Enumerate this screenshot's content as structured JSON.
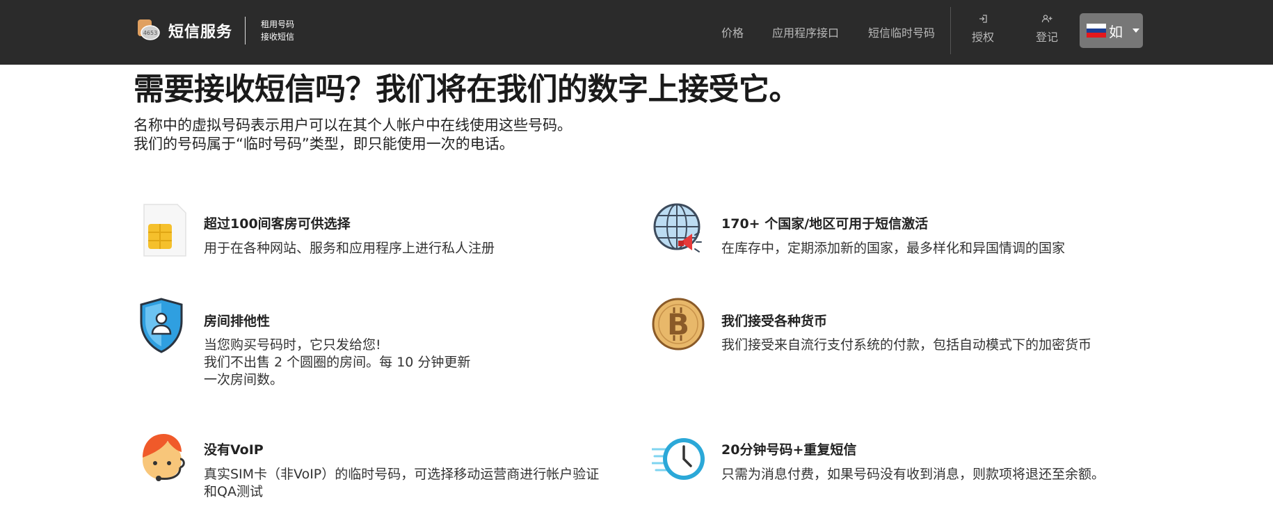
{
  "header": {
    "brand_name": "短信服务",
    "tagline_1": "租用号码",
    "tagline_2": "接收短信",
    "logo_text": "4653",
    "nav": {
      "price": "价格",
      "api": "应用程序接口",
      "temp_numbers": "短信临时号码",
      "login": "授权",
      "register": "登记"
    },
    "language_label": "如",
    "flag_colors": [
      "#ffffff",
      "#1c3f94",
      "#e4181c"
    ]
  },
  "hero": {
    "title": "需要接收短信吗？我们将在我们的数字上接受它。",
    "line1": "名称中的虚拟号码表示用户可以在其个人帐户中在线使用这些号码。",
    "line2": "我们的号码属于“临时号码”类型，即只能使用一次的电话。"
  },
  "features": [
    {
      "icon": "sim-card-icon",
      "title": "超过100间客房可供选择",
      "desc_lines": [
        "用于在各种网站、服务和应用程序上进行私人注册"
      ]
    },
    {
      "icon": "globe-megaphone-icon",
      "title": "170+ 个国家/地区可用于短信激活",
      "desc_lines": [
        "在库存中，定期添加新的国家，最多样化和异国情调的国家"
      ]
    },
    {
      "icon": "shield-user-icon",
      "title": "房间排他性",
      "desc_lines": [
        "当您购买号码时，它只发给您!",
        "我们不出售 2 个圆圈的房间。每 10 分钟更新",
        "一次房间数。"
      ]
    },
    {
      "icon": "bitcoin-icon",
      "title": "我们接受各种货币",
      "desc_lines": [
        "我们接受来自流行支付系统的付款，包括自动模式下的加密货币"
      ]
    },
    {
      "icon": "support-agent-icon",
      "title": "没有VoIP",
      "desc_lines": [
        "真实SIM卡（非VoIP）的临时号码，可选择移动运营商进行帐户验证",
        "和QA测试"
      ]
    },
    {
      "icon": "fast-clock-icon",
      "title": "20分钟号码+重复短信",
      "desc_lines": [
        "只需为消息付费，如果号码没有收到消息，则款项将退还至余额。"
      ]
    }
  ]
}
